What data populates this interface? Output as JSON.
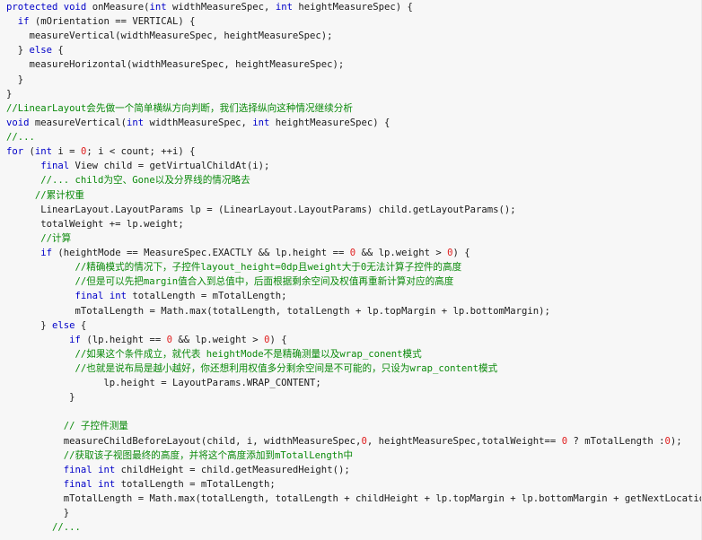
{
  "code": {
    "language": "java",
    "lines": [
      "protected void onMeasure(int widthMeasureSpec, int heightMeasureSpec) {",
      "  if (mOrientation == VERTICAL) {",
      "    measureVertical(widthMeasureSpec, heightMeasureSpec);",
      "  } else {",
      "    measureHorizontal(widthMeasureSpec, heightMeasureSpec);",
      "  }",
      "}",
      "//LinearLayout会先做一个简单横纵方向判断，我们选择纵向这种情况继续分析",
      "void measureVertical(int widthMeasureSpec, int heightMeasureSpec) {",
      "//...",
      "for (int i = 0; i < count; ++i) {",
      "      final View child = getVirtualChildAt(i);",
      "      //... child为空、Gone以及分界线的情况略去",
      "     //累计权重",
      "      LinearLayout.LayoutParams lp = (LinearLayout.LayoutParams) child.getLayoutParams();",
      "      totalWeight += lp.weight;",
      "      //计算",
      "      if (heightMode == MeasureSpec.EXACTLY && lp.height == 0 && lp.weight > 0) {",
      "            //精确模式的情况下，子控件layout_height=0dp且weight大于0无法计算子控件的高度",
      "            //但是可以先把margin值合入到总值中，后面根据剩余空间及权值再重新计算对应的高度",
      "            final int totalLength = mTotalLength;",
      "            mTotalLength = Math.max(totalLength, totalLength + lp.topMargin + lp.bottomMargin);",
      "      } else {",
      "           if (lp.height == 0 && lp.weight > 0) {",
      "            //如果这个条件成立，就代表 heightMode不是精确测量以及wrap_conent模式",
      "            //也就是说布局是越小越好，你还想利用权值多分剩余空间是不可能的，只设为wrap_content模式",
      "                 lp.height = LayoutParams.WRAP_CONTENT;",
      "           }",
      "",
      "          // 子控件测量",
      "          measureChildBeforeLayout(child, i, widthMeasureSpec,0, heightMeasureSpec,totalWeight== 0 ? mTotalLength :0);",
      "          //获取该子视图最终的高度，并将这个高度添加到mTotalLength中",
      "          final int childHeight = child.getMeasuredHeight();",
      "          final int totalLength = mTotalLength;",
      "          mTotalLength = Math.max(totalLength, totalLength + childHeight + lp.topMargin + lp.bottomMargin + getNextLocationOffset(child));",
      "          }",
      "        //..."
    ]
  }
}
